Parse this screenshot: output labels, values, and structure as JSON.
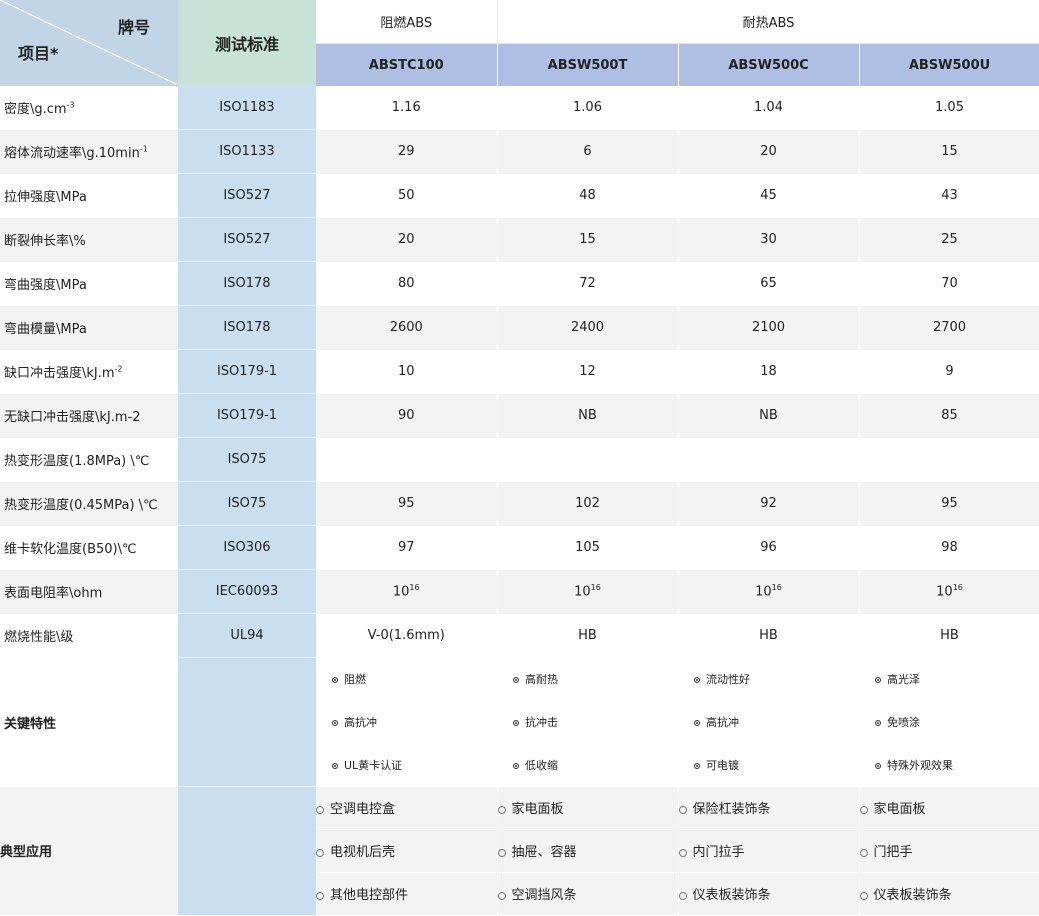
{
  "header": {
    "brand_label": "牌号",
    "item_label": "项目*",
    "standard_label": "测试标准",
    "group_flame": "阻燃ABS",
    "group_heat": "耐热ABS",
    "grades": [
      "ABSTC100",
      "ABSW500T",
      "ABSW500C",
      "ABSW500U"
    ]
  },
  "rows": [
    {
      "label": "密度\\g.cm",
      "sup": "-3",
      "std": "ISO1183",
      "values": [
        "1.16",
        "1.06",
        "1.04",
        "1.05"
      ]
    },
    {
      "label": "熔体流动速率\\g.10min",
      "sup": "-1",
      "std": "ISO1133",
      "values": [
        "29",
        "6",
        "20",
        "15"
      ]
    },
    {
      "label": "拉伸强度\\MPa",
      "sup": "",
      "std": "ISO527",
      "values": [
        "50",
        "48",
        "45",
        "43"
      ]
    },
    {
      "label": "断裂伸长率\\%",
      "sup": "",
      "std": "ISO527",
      "values": [
        "20",
        "15",
        "30",
        "25"
      ]
    },
    {
      "label": "弯曲强度\\MPa",
      "sup": "",
      "std": "ISO178",
      "values": [
        "80",
        "72",
        "65",
        "70"
      ]
    },
    {
      "label": "弯曲模量\\MPa",
      "sup": "",
      "std": "ISO178",
      "values": [
        "2600",
        "2400",
        "2100",
        "2700"
      ]
    },
    {
      "label": "缺口冲击强度\\kJ.m",
      "sup": "-2",
      "std": "ISO179-1",
      "values": [
        "10",
        "12",
        "18",
        "9"
      ]
    },
    {
      "label": "无缺口冲击强度\\kJ.m-2",
      "sup": "",
      "std": "ISO179-1",
      "values": [
        "90",
        "NB",
        "NB",
        "85"
      ]
    },
    {
      "label": "热变形温度(1.8MPa) \\℃",
      "sup": "",
      "std": "ISO75",
      "values": [
        "",
        "",
        "",
        ""
      ]
    },
    {
      "label": "热变形温度(0.45MPa) \\℃",
      "sup": "",
      "std": "ISO75",
      "values": [
        "95",
        "102",
        "92",
        "95"
      ]
    },
    {
      "label": "维卡软化温度(B50)\\℃",
      "sup": "",
      "std": "ISO306",
      "values": [
        "97",
        "105",
        "96",
        "98"
      ]
    },
    {
      "label": "表面电阻率\\ohm",
      "sup": "",
      "std": "IEC60093",
      "values": [
        "10",
        "10",
        "10",
        "10"
      ],
      "value_sup": "16"
    },
    {
      "label": "燃烧性能\\级",
      "sup": "",
      "std": "UL94",
      "values": [
        "V-0(1.6mm)",
        "HB",
        "HB",
        "HB"
      ]
    }
  ],
  "features": {
    "label": "关键特性",
    "lines": [
      [
        "阻燃",
        "高耐热",
        "流动性好",
        "高光泽"
      ],
      [
        "高抗冲",
        "抗冲击",
        "高抗冲",
        "免喷涂"
      ],
      [
        "UL黄卡认证",
        "低收缩",
        "可电镀",
        "特殊外观效果"
      ]
    ]
  },
  "applications": {
    "label": "典型应用",
    "lines": [
      [
        "空调电控盒",
        "家电面板",
        "保险杠装饰条",
        "家电面板"
      ],
      [
        "电视机后壳",
        "抽屉、容器",
        "内门拉手",
        "门把手"
      ],
      [
        "其他电控部件",
        "空调挡风条",
        "仪表板装饰条",
        "仪表板装饰条"
      ]
    ]
  }
}
